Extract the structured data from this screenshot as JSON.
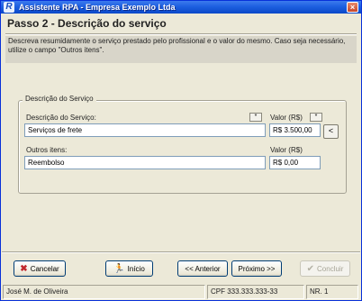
{
  "window": {
    "title": "Assistente RPA - Empresa Exemplo Ltda",
    "close": "×"
  },
  "header": {
    "step_title": "Passo 2 -   Descrição do serviço",
    "description": "Descreva resumidamente o serviço prestado pelo profissional e o valor do mesmo. Caso seja necessário, utilize o campo \"Outros itens\"."
  },
  "group": {
    "legend": "Descrição do Serviço",
    "service_label": "Descrição do Serviço:",
    "service_value": "Serviços de frete",
    "service_btn": "*",
    "valor_label": "Valor (R$)",
    "valor_btn": "*",
    "valor_value": "R$ 3.500,00",
    "side_btn": "<",
    "outros_label": "Outros itens:",
    "outros_value": "Reembolso",
    "valor2_label": "Valor (R$)",
    "valor2_value": "R$ 0,00"
  },
  "buttons": {
    "cancel": "Cancelar",
    "home": "Início",
    "prev": "<< Anterior",
    "next": "Próximo >>",
    "finish": "Concluir"
  },
  "icons": {
    "cancel": "close-icon",
    "home": "running-person-icon",
    "finish": "check-icon"
  },
  "status": {
    "name": "José M. de Oliveira",
    "cpf": "CPF 333.333.333-33",
    "nr": "NR. 1"
  },
  "colors": {
    "titlebar": "#0a48c8",
    "window_bg": "#ece9d8",
    "cancel_icon": "#c0272d",
    "home_icon": "#1f7a1f"
  }
}
